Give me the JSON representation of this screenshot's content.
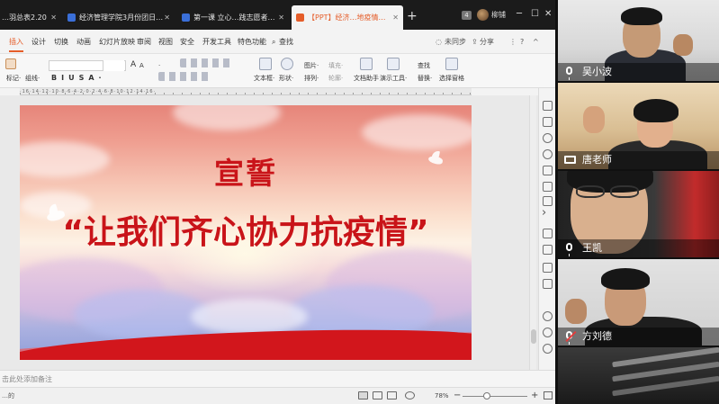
{
  "tabs": [
    {
      "label": "…羽总表2.20",
      "icon_color": "#3a6fd8"
    },
    {
      "label": "经济管理学院3月份团日活动计划",
      "icon_color": "#3a6fd8"
    },
    {
      "label": "第一课 立心…践志愿者发言)",
      "icon_color": "#3a6fd8"
    },
    {
      "label": "【PPT】经济…地疫情开展典礼",
      "icon_color": "#e55d29"
    }
  ],
  "tab_badge": "4",
  "user_name": "柳铺",
  "menu": {
    "items": [
      "插入",
      "设计",
      "切换",
      "动画",
      "幻灯片放映",
      "审阅",
      "视图",
      "安全",
      "开发工具",
      "特色功能"
    ],
    "selected": "插入",
    "search": "查找",
    "sync": "未同步",
    "share": "分享"
  },
  "ribbon": {
    "paste_label": "标记·",
    "line_label": "组线·",
    "dots": "·",
    "text_box": "文本框·",
    "shape": "形状·",
    "arrange": "排列·",
    "picture": "图片·",
    "fill": "填充·",
    "outline": "轮廓·",
    "doc_helper": "文档助手",
    "presentation_tools": "演示工具·",
    "find": "查找",
    "replace": "替换·",
    "select_pane": "选择窗格",
    "font_size_up": "A",
    "font_size_down": "A",
    "format_chars": "BIUSA·"
  },
  "ruler_numbers": "·16·14·12·10·8·6·4·2·0·2·4·6·8·10·12·14·16·",
  "slide": {
    "title": "宣誓",
    "subtitle": "“让我们齐心协力抗疫情”",
    "title_color": "#c91419",
    "band_color": "#d2161c"
  },
  "notes_placeholder": "击此处添加备注",
  "status": {
    "left": "…的",
    "zoom": "78%",
    "zoom_fraction": 0.45,
    "minus": "−",
    "plus": "+"
  },
  "participants": [
    {
      "name": "吴小波",
      "mic": "on"
    },
    {
      "name": "唐老师",
      "mic": "screen"
    },
    {
      "name": "王凯",
      "mic": "on"
    },
    {
      "name": "方刘德",
      "mic": "muted"
    }
  ]
}
